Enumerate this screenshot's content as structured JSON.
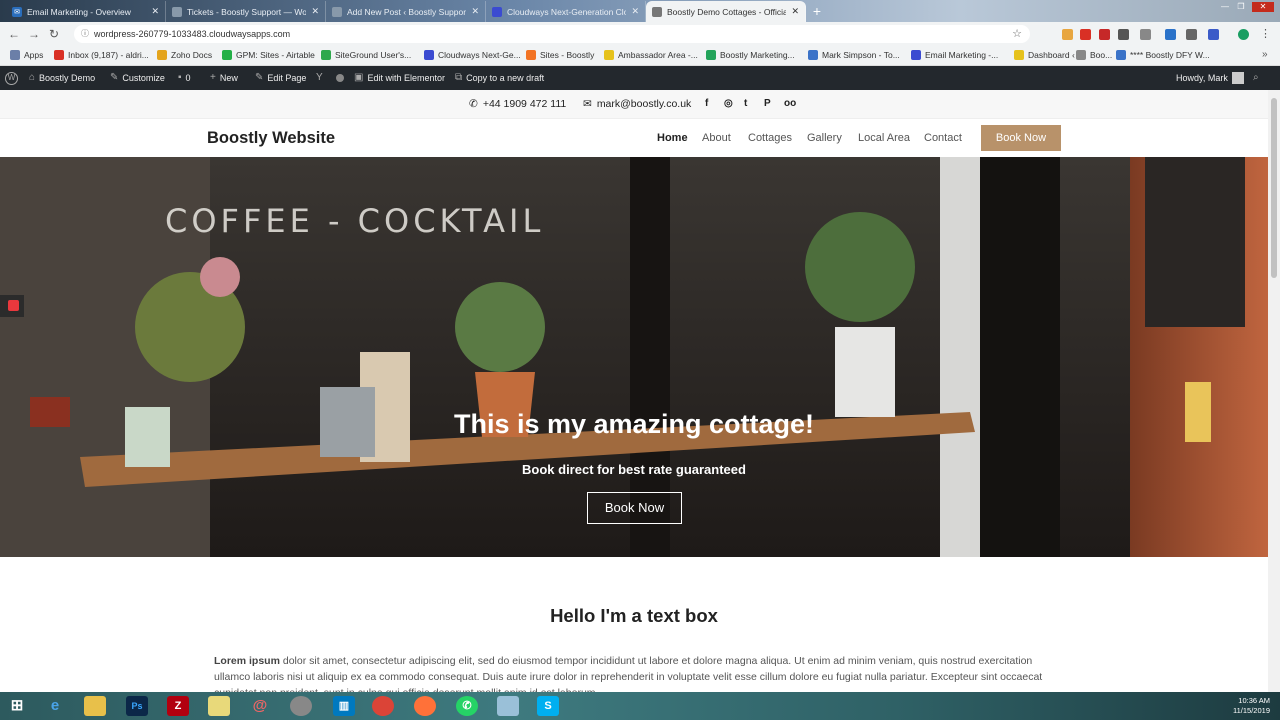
{
  "browser": {
    "tabs": [
      {
        "title": "Email Marketing - Overview",
        "fav_color": "#2a6ebc",
        "fav_icon": "email-app-icon",
        "active": false
      },
      {
        "title": "Tickets - Boostly Support — Wo",
        "fav_color": "#8899aa",
        "fav_icon": "globe-icon",
        "active": false
      },
      {
        "title": "Add New Post ‹ Boostly Support",
        "fav_color": "#8899aa",
        "fav_icon": "globe-icon",
        "active": false
      },
      {
        "title": "Cloudways Next-Generation Clo",
        "fav_color": "#3b4bd1",
        "fav_icon": "cloud-icon",
        "active": false
      },
      {
        "title": "Boostly Demo Cottages - Officia",
        "fav_color": "#777777",
        "fav_icon": "globe-icon",
        "active": true
      }
    ],
    "new_tab": "+",
    "url": "wordpress-260779-1033483.cloudwaysapps.com"
  },
  "bookmarks": [
    {
      "label": "Apps",
      "color": "#6b7fa8"
    },
    {
      "label": "Inbox (9,187) - aldri...",
      "color": "#d93025"
    },
    {
      "label": "Zoho Docs",
      "color": "#e4a41c"
    },
    {
      "label": "GPM: Sites - Airtable",
      "color": "#24b047"
    },
    {
      "label": "SiteGround User's...",
      "color": "#2ea84c"
    },
    {
      "label": "Cloudways Next-Ge...",
      "color": "#3b4bd1"
    },
    {
      "label": "Sites - Boostly",
      "color": "#f27324"
    },
    {
      "label": "Ambassador Area -...",
      "color": "#e6c21c"
    },
    {
      "label": "Boostly Marketing...",
      "color": "#22a35a"
    },
    {
      "label": "Mark Simpson - To...",
      "color": "#3b73c8"
    },
    {
      "label": "Email Marketing -...",
      "color": "#3b4bd1"
    },
    {
      "label": "Dashboard ‹",
      "color": "#e6c21c"
    },
    {
      "label": "Boo...",
      "color": "#888888"
    },
    {
      "label": "**** Boostly DFY W...",
      "color": "#3b73c8"
    }
  ],
  "wpbar": {
    "site": "Boostly Demo",
    "customize": "Customize",
    "comments": "0",
    "new": "New",
    "edit_page": "Edit Page",
    "elementor": "Edit with Elementor",
    "copy": "Copy to a new draft",
    "howdy": "Howdy, Mark"
  },
  "topinfo": {
    "phone": "+44 1909 472 111",
    "email": "mark@boostly.co.uk",
    "social": [
      "facebook-icon",
      "instagram-icon",
      "twitter-icon",
      "pinterest-icon",
      "tripadvisor-icon"
    ]
  },
  "header": {
    "logo": "Boostly Website",
    "nav": [
      "Home",
      "About",
      "Cottages",
      "Gallery",
      "Local Area",
      "Contact"
    ],
    "cta": "Book Now",
    "cta_color": "#b8926a"
  },
  "hero": {
    "title": "This is my amazing cottage!",
    "subtitle": "Book direct for best rate guaranteed",
    "button": "Book Now",
    "window_sign": "COFFEE - COCKTAILS"
  },
  "content": {
    "heading": "Hello I'm a text box",
    "lead": "Lorem ipsum",
    "body": " dolor sit amet, consectetur adipiscing elit, sed do eiusmod tempor incididunt ut labore et dolore magna aliqua. Ut enim ad minim veniam, quis nostrud exercitation ullamco laboris nisi ut aliquip ex ea commodo consequat. Duis aute irure dolor in reprehenderit in voluptate velit esse cillum dolore eu fugiat nulla pariatur. Excepteur sint occaecat cupidatat non proident, sunt in culpa qui officia deserunt mollit anim id est laborum."
  },
  "taskbar": {
    "time": "10:36 AM",
    "date": "11/15/2019",
    "apps": [
      "windows-start-icon",
      "internet-explorer-icon",
      "file-explorer-icon",
      "photoshop-icon",
      "filezilla-icon",
      "notes-icon",
      "spiral-app-icon",
      "settings-app-icon",
      "trello-icon",
      "chrome-icon",
      "firefox-icon",
      "whatsapp-icon",
      "notepad-icon",
      "skype-icon"
    ]
  }
}
